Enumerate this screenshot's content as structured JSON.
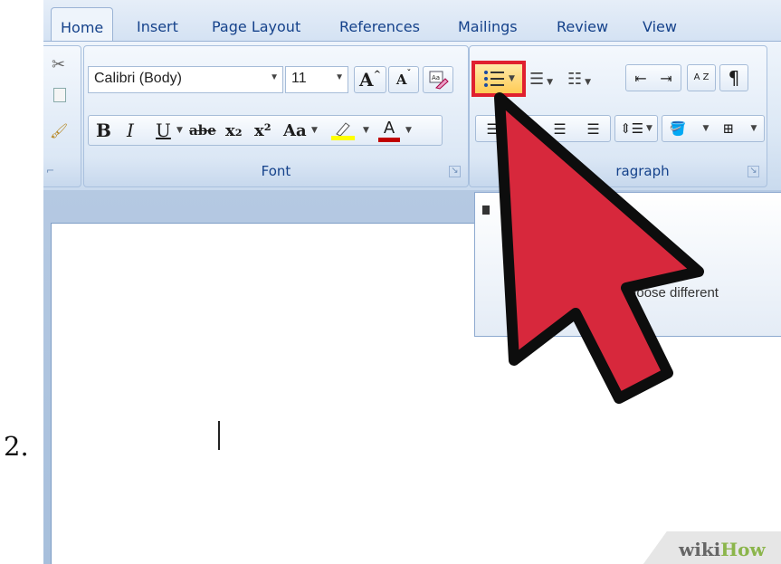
{
  "step": {
    "number": "2."
  },
  "tabs": [
    {
      "label": "Home"
    },
    {
      "label": "Insert"
    },
    {
      "label": "Page Layout"
    },
    {
      "label": "References"
    },
    {
      "label": "Mailings"
    },
    {
      "label": "Review"
    },
    {
      "label": "View"
    }
  ],
  "font_group": {
    "label": "Font",
    "font_name": "Calibri (Body)",
    "font_size": "11",
    "bold": "B",
    "italic": "I",
    "underline": "U",
    "strikethrough": "abe",
    "subscript": "x₂",
    "superscript": "x²",
    "change_case": "Aa",
    "grow_font": "A",
    "shrink_font": "A",
    "font_color": "A"
  },
  "paragraph_group": {
    "label": "Paragraph",
    "label_visible": "ragraph",
    "sort": "A Z",
    "show_marks": "¶"
  },
  "tooltip": {
    "text": "o choose different"
  },
  "watermark": {
    "wiki": "wiki",
    "how": "How"
  },
  "colors": {
    "highlight_bar": "#ffff00",
    "font_color_bar": "#c00000",
    "arrow_fill": "#d7283c",
    "selection_box": "#e0202f"
  },
  "icons": [
    "bullets-icon",
    "numbering-icon",
    "multilevel-list-icon",
    "decrease-indent-icon",
    "increase-indent-icon",
    "sort-icon",
    "show-marks-icon",
    "highlight-icon",
    "shading-icon",
    "borders-icon",
    "line-spacing-icon",
    "cursor-arrow-icon"
  ]
}
